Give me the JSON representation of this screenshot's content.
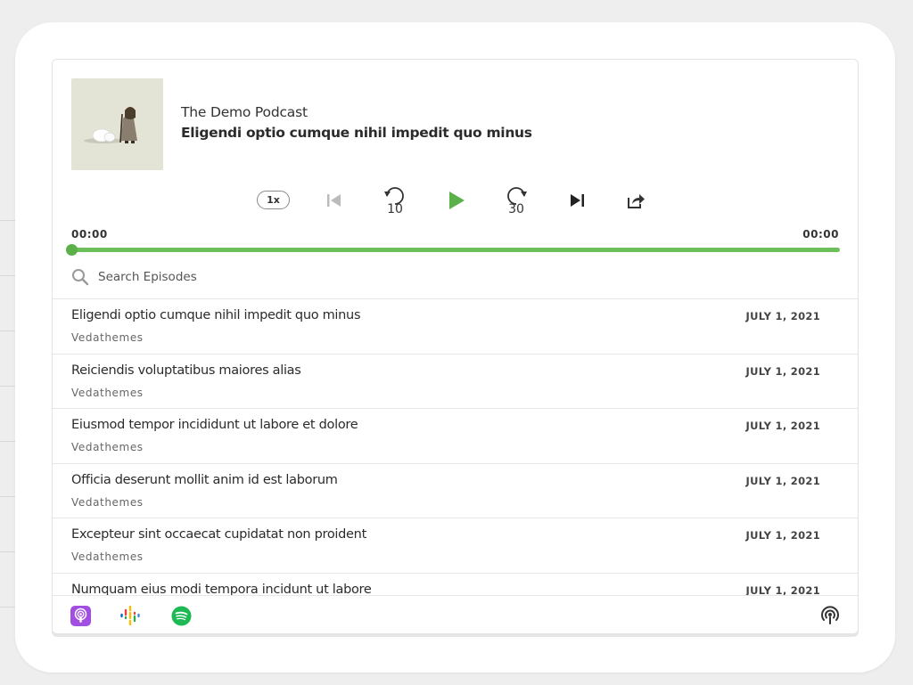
{
  "player": {
    "podcast_name": "The Demo Podcast",
    "episode_title": "Eligendi optio cumque nihil impedit quo minus",
    "speed_label": "1x",
    "rewind_seconds": "10",
    "forward_seconds": "30",
    "current_time": "00:00",
    "total_time": "00:00",
    "progress": 0
  },
  "search": {
    "placeholder": "Search Episodes"
  },
  "episodes": [
    {
      "title": "Eligendi optio cumque nihil impedit quo minus",
      "author": "Vedathemes",
      "date": "JULY 1, 2021"
    },
    {
      "title": "Reiciendis voluptatibus maiores alias",
      "author": "Vedathemes",
      "date": "JULY 1, 2021"
    },
    {
      "title": "Eiusmod tempor incididunt ut labore et dolore",
      "author": "Vedathemes",
      "date": "JULY 1, 2021"
    },
    {
      "title": "Officia deserunt mollit anim id est laborum",
      "author": "Vedathemes",
      "date": "JULY 1, 2021"
    },
    {
      "title": "Excepteur sint occaecat cupidatat non proident",
      "author": "Vedathemes",
      "date": "JULY 1, 2021"
    },
    {
      "title": "Numquam eius modi tempora incidunt ut labore",
      "author": "",
      "date": "JULY 1, 2021"
    }
  ],
  "platforms": [
    "apple-podcasts-icon",
    "google-podcasts-icon",
    "spotify-icon",
    "podcast-feed-icon"
  ],
  "colors": {
    "accent": "#5bb04a",
    "apple_podcasts": "#a24ee0",
    "spotify": "#1db954"
  }
}
